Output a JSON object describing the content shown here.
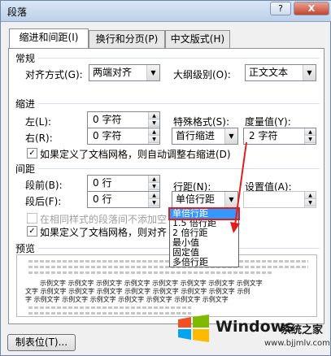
{
  "window": {
    "title": "段落",
    "help_label": "?",
    "close_label": "X"
  },
  "tabs": [
    "缩进和间距(I)",
    "换行和分页(P)",
    "中文版式(H)"
  ],
  "general": {
    "heading": "常规",
    "alignment_label": "对齐方式(G):",
    "alignment_value": "两端对齐",
    "outline_label": "大纲级别(O):",
    "outline_value": "正文文本"
  },
  "indent": {
    "heading": "缩进",
    "left_label": "左(L):",
    "left_value": "0 字符",
    "right_label": "右(R):",
    "right_value": "0 字符",
    "special_label": "特殊格式(S):",
    "special_value": "首行缩进",
    "by_label": "度量值(Y):",
    "by_value": "2 字符",
    "auto_adjust_label": "如果定义了文档网格，则自动调整右缩进(D)"
  },
  "spacing": {
    "heading": "间距",
    "before_label": "段前(B):",
    "before_value": "0 行",
    "after_label": "段后(F):",
    "after_value": "0 行",
    "line_label": "行距(N):",
    "line_value": "单倍行距",
    "at_label": "设置值(A):",
    "same_style_label": "在相同样式的段落间不添加空",
    "grid_label": "如果定义了文档网格，则对齐",
    "line_options": [
      "单倍行距",
      "1.5 倍行距",
      "2 倍行距",
      "最小值",
      "固定值",
      "多倍行距"
    ]
  },
  "preview": {
    "heading": "预览",
    "sample_lines": [
      "示例文字 示例文字 示例文字 示例文字 示例文字 示例文字 示例文字 示例文字",
      "文字 示例文字 示例文字 示例文字 示例文字 示例文字 示例文字 示例文字 示例",
      "字 示例文字 示例文字 示例文字 示例文字 示例文字 示例文字 示例文字"
    ]
  },
  "footer": {
    "tabs_button": "制表位(T)..."
  },
  "watermark": {
    "brand": "Windows",
    "suffix": "系统之家",
    "url": "www.bjjmlv.com"
  },
  "colors": {
    "accent": "#3399ff",
    "highlight": "#e11d1d"
  }
}
